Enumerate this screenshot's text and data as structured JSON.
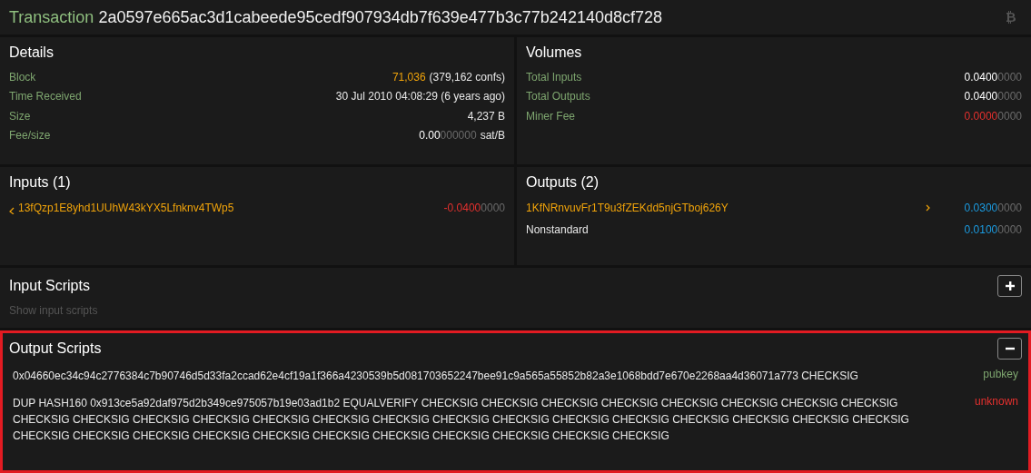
{
  "header": {
    "label": "Transaction",
    "hash": "2a0597e665ac3d1cabeede95cedf907934db7f639e477b3c77b242140d8cf728"
  },
  "details": {
    "title": "Details",
    "rows": [
      {
        "label": "Block",
        "link": "71,036",
        "value": "(379,162 confs)"
      },
      {
        "label": "Time Received",
        "value": "30 Jul 2010 04:08:29 (6 years ago)"
      },
      {
        "label": "Size",
        "value": "4,237 B"
      },
      {
        "label": "Fee/size",
        "amount": {
          "main": "0.00",
          "dim": "000000",
          "kind": "neutral"
        },
        "unit": "sat/B"
      }
    ]
  },
  "volumes": {
    "title": "Volumes",
    "rows": [
      {
        "label": "Total Inputs",
        "amount": {
          "main": "0.0400",
          "dim": "0000",
          "kind": "neutral"
        }
      },
      {
        "label": "Total Outputs",
        "amount": {
          "main": "0.0400",
          "dim": "0000",
          "kind": "neutral"
        }
      },
      {
        "label": "Miner Fee",
        "amount": {
          "main": "0.0000",
          "dim": "0000",
          "kind": "negative"
        }
      }
    ]
  },
  "inputs": {
    "title": "Inputs (1)",
    "items": [
      {
        "address": "13fQzp1E8yhd1UUhW43kYX5Lfnknv4TWp5",
        "kind": "link",
        "amount": {
          "main": "-0.0400",
          "dim": "0000",
          "kind": "negative"
        }
      }
    ]
  },
  "outputs": {
    "title": "Outputs (2)",
    "items": [
      {
        "address": "1KfNRnvuvFr1T9u3fZEKdd5njGTboj626Y",
        "kind": "link",
        "spent_arrow": true,
        "amount": {
          "main": "0.0300",
          "dim": "0000",
          "kind": "positive"
        }
      },
      {
        "address": "Nonstandard",
        "kind": "plain",
        "spent_arrow": false,
        "amount": {
          "main": "0.0100",
          "dim": "0000",
          "kind": "positive"
        }
      }
    ]
  },
  "input_scripts": {
    "title": "Input Scripts",
    "expanded": false,
    "hint": "Show input scripts"
  },
  "output_scripts": {
    "title": "Output Scripts",
    "expanded": true,
    "highlighted": true,
    "scripts": [
      {
        "text": "0x04660ec34c94c2776384c7b90746d5d33fa2ccad62e4cf19a1f366a4230539b5d081703652247bee91c9a565a55852b82a3e1068bdd7e670e2268aa4d36071a773 CHECKSIG",
        "type": "pubkey",
        "kind": "known"
      },
      {
        "text": "DUP HASH160 0x913ce5a92daf975d2b349ce975057b19e03ad1b2 EQUALVERIFY CHECKSIG CHECKSIG CHECKSIG CHECKSIG CHECKSIG CHECKSIG CHECKSIG CHECKSIG CHECKSIG CHECKSIG CHECKSIG CHECKSIG CHECKSIG CHECKSIG CHECKSIG CHECKSIG CHECKSIG CHECKSIG CHECKSIG CHECKSIG CHECKSIG CHECKSIG CHECKSIG CHECKSIG CHECKSIG CHECKSIG CHECKSIG CHECKSIG CHECKSIG CHECKSIG CHECKSIG CHECKSIG CHECKSIG CHECKSIG",
        "type": "unknown",
        "kind": "unknown"
      }
    ]
  }
}
